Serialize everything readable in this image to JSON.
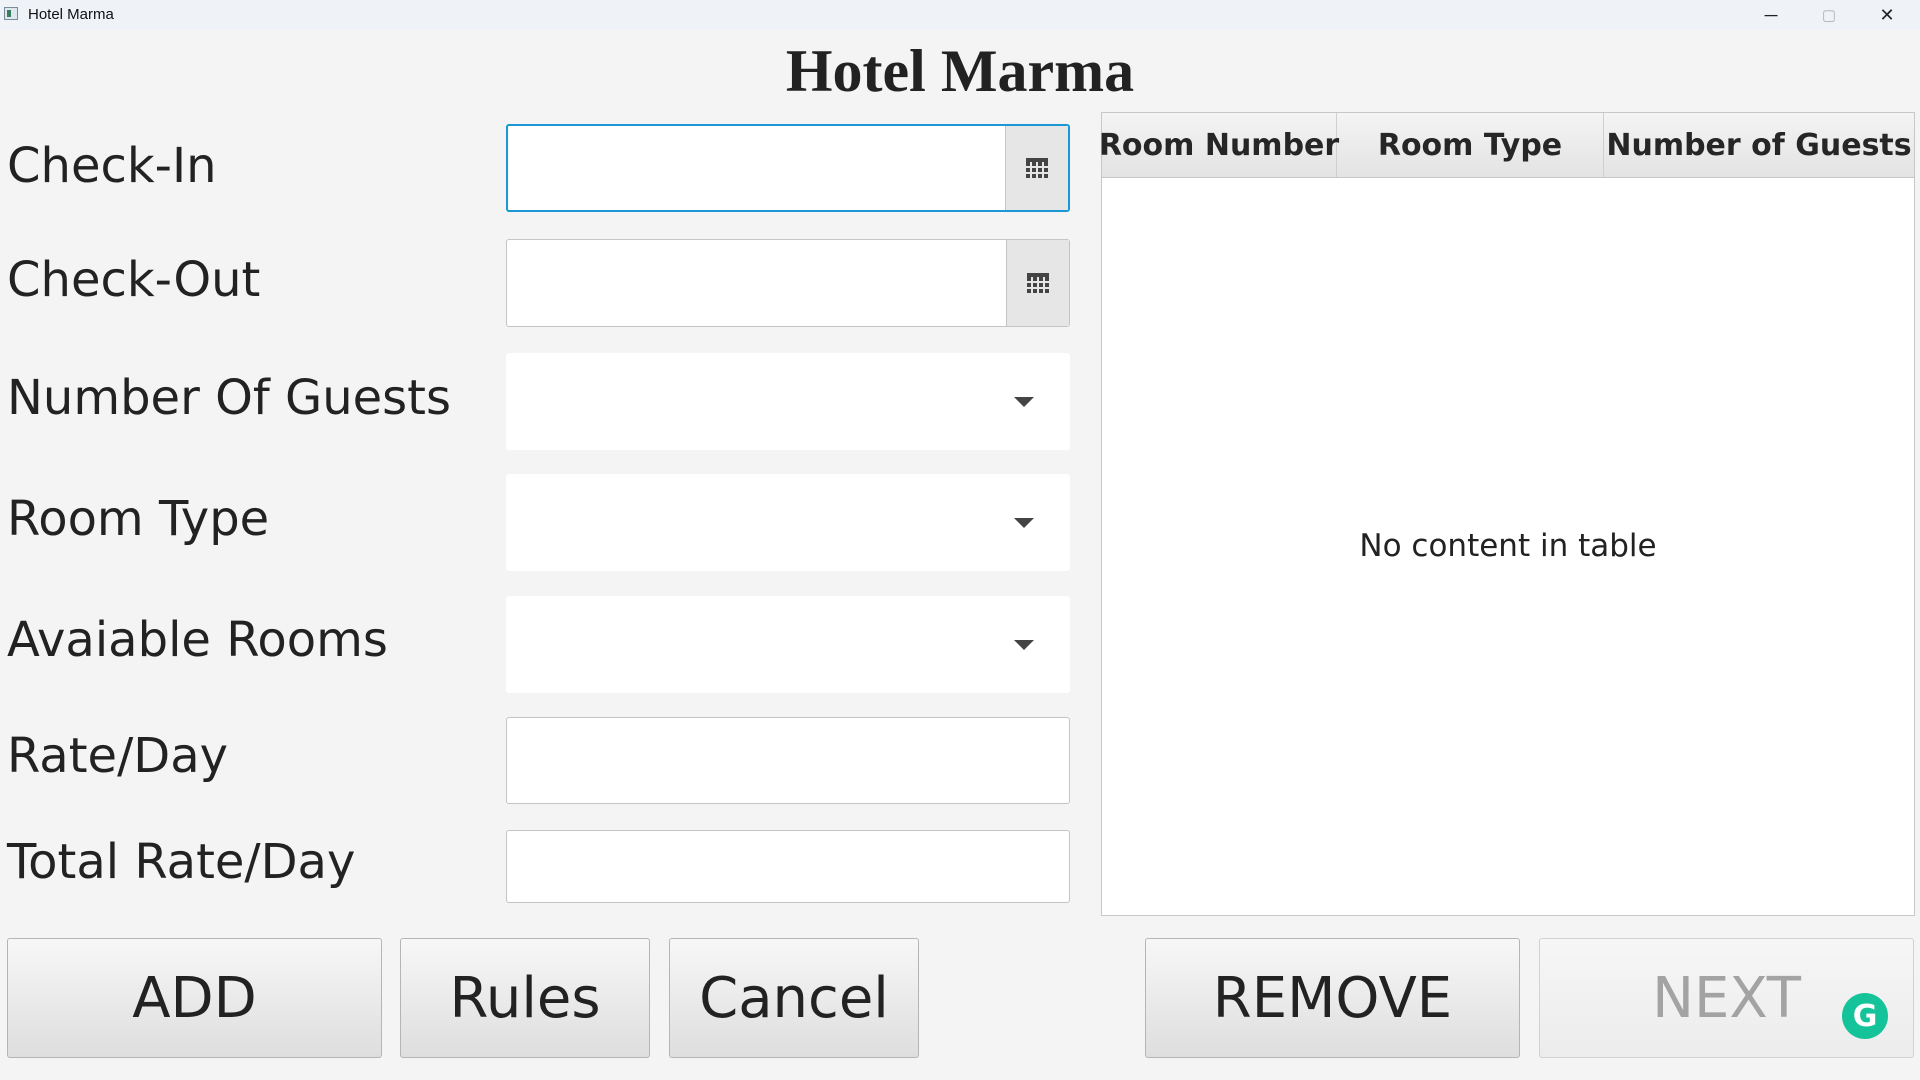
{
  "window": {
    "title": "Hotel Marma",
    "minimize_glyph": "─",
    "maximize_glyph": "▢",
    "close_glyph": "✕"
  },
  "page_title": "Hotel Marma",
  "form": {
    "check_in": {
      "label": "Check-In",
      "value": "",
      "icon": "calendar-icon"
    },
    "check_out": {
      "label": "Check-Out",
      "value": "",
      "icon": "calendar-icon"
    },
    "guests": {
      "label": "Number Of Guests",
      "value": ""
    },
    "room_type": {
      "label": "Room Type",
      "value": ""
    },
    "available_rooms": {
      "label": "Avaiable Rooms",
      "value": ""
    },
    "rate_day": {
      "label": "Rate/Day",
      "value": ""
    },
    "total_rate_day": {
      "label": "Total Rate/Day",
      "value": ""
    }
  },
  "table": {
    "columns": [
      "Room Number",
      "Room Type",
      "Number of Guests"
    ],
    "rows": [],
    "empty_message": "No content in table"
  },
  "buttons": {
    "add": "ADD",
    "rules": "Rules",
    "cancel": "Cancel",
    "remove": "REMOVE",
    "next": "NEXT"
  },
  "overlay": {
    "grammarly_glyph": "G"
  },
  "colors": {
    "focus_border": "#1a98d4",
    "grammarly": "#15c39a"
  }
}
